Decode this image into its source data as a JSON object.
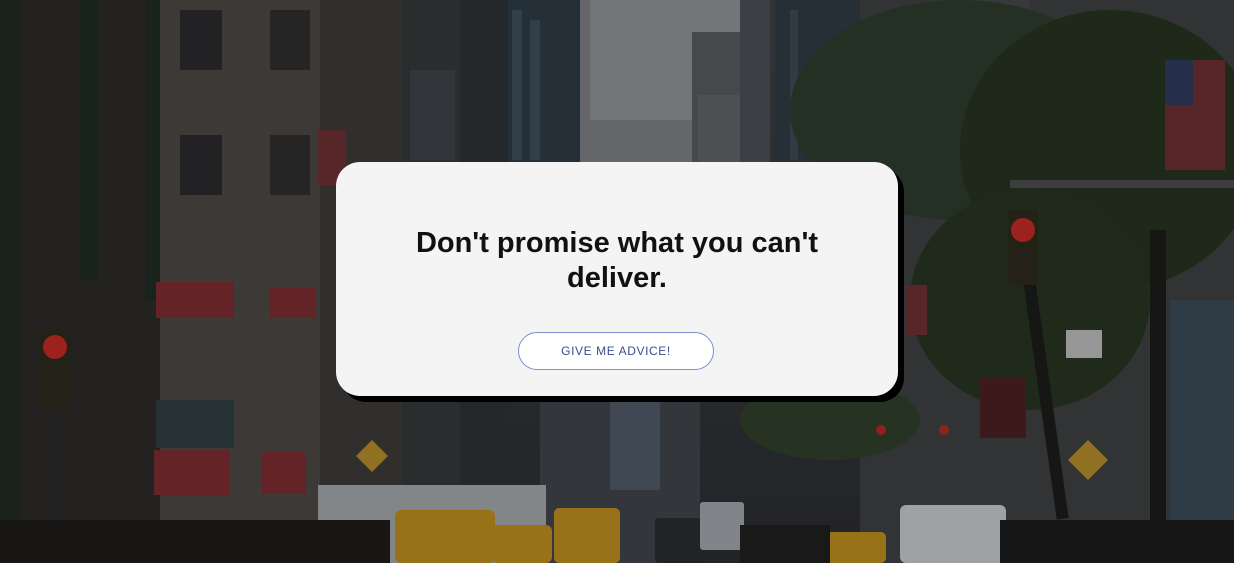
{
  "background": {
    "image": "city-street-photo",
    "overlay_color": "#000000"
  },
  "card": {
    "advice_text": "Don't promise what you can't deliver.",
    "button_label": "GIVE ME ADVICE!",
    "background_color": "#f4f4f5",
    "button_border_color": "#7d8fcc",
    "button_text_color": "#3b4e8a"
  }
}
